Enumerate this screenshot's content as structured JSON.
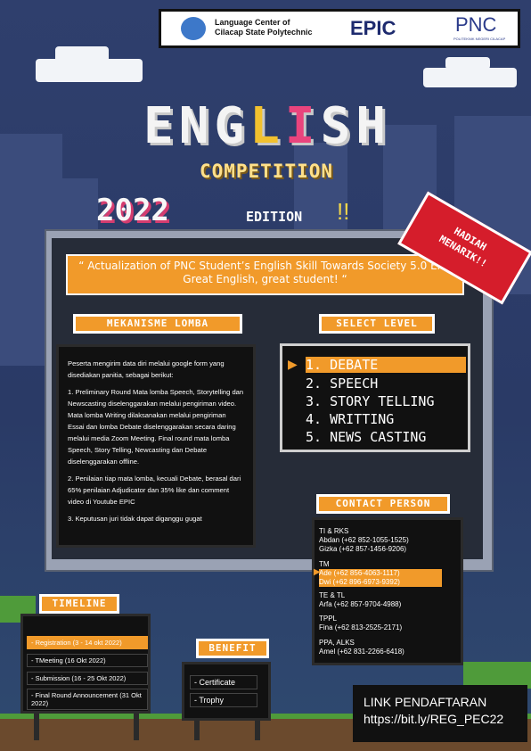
{
  "header": {
    "org_name": "Language Center of Cilacap State Polytechnic",
    "epic_logo": "EPIC",
    "pnc_logo": "PNC",
    "pnc_subtitle": "POLITEKNIK NEGERI CILACAP"
  },
  "title": {
    "letters": [
      "E",
      "N",
      "G",
      "L",
      "I",
      "S",
      "H"
    ],
    "letter_colors": [
      "#f4f4f4",
      "#f4f4f4",
      "#f4f4f4",
      "#f2c12e",
      "#e9447d",
      "#f4f4f4",
      "#f4f4f4"
    ],
    "subtitle": "COMPETITION",
    "year": "2022",
    "edition": "EDITION",
    "bang": "!!"
  },
  "ribbon": {
    "line1": "HADIAH",
    "line2": "MENARIK!!"
  },
  "quote": "“ Actualization of PNC Student’s English Skill Towards Society 5.0 Era. Great English, great student! “",
  "mekanisme": {
    "heading": "MEKANISME LOMBA",
    "intro": "Peserta mengirim data diri melalui google form yang disediakan panitia, sebagai berikut:",
    "items": [
      "1.   Preliminary Round Mata lomba Speech, Storytelling dan Newscasting diselenggarakan melalui pengiriman video. Mata lomba Writing dilaksanakan melalui pengiriman Essai dan lomba Debate diselenggarakan secara daring melalui media Zoom Meeting. Final round mata lomba Speech, Story Telling, Newcasting dan Debate diselenggarakan offline.",
      "2. Penilaian tiap mata lomba, kecuali Debate, berasal dari 65% penilaian Adjudicator dan 35% like dan comment video di Youtube EPIC",
      "3.   Keputusan juri tidak dapat diganggu gugat"
    ]
  },
  "level": {
    "heading": "SELECT LEVEL",
    "items": [
      "1. DEBATE",
      "2. SPEECH",
      "3. STORY TELLING",
      "4. WRITTING",
      "5. NEWS CASTING"
    ],
    "selected_index": 0,
    "cursor": "▶"
  },
  "contact": {
    "heading": "CONTACT PERSON",
    "groups": [
      {
        "name": "TI & RKS",
        "lines": [
          "Abdan (+62 852-1055-1525)",
          "Gizka (+62 857-1456-9206)"
        ]
      },
      {
        "name": "TM",
        "lines": [
          "Ade (+62 856-4063-1117)",
          "Dwi (+62 896-6973-9392)"
        ]
      },
      {
        "name": "TE & TL",
        "lines": [
          "Arfa (+62 857-9704-4988)"
        ]
      },
      {
        "name": "TPPL",
        "lines": [
          "Fina (+62 813-2525-2171)"
        ]
      },
      {
        "name": "PPA, ALKS",
        "lines": [
          "Amel (+62 831-2266-6418)"
        ]
      }
    ],
    "selected_index": 1,
    "cursor": "▶"
  },
  "timeline": {
    "heading": "TIMELINE",
    "items": [
      "- Registration (3 - 14 okt 2022)",
      "- TMeeting (16 Okt 2022)",
      "- Submission (16 - 25 Okt 2022)",
      "- Final Round Announcement (31 Okt 2022)"
    ]
  },
  "benefit": {
    "heading": "BENEFIT",
    "items": [
      "- Certificate",
      "- Trophy"
    ]
  },
  "link": {
    "label": "LINK PENDAFTARAN",
    "url": "https://bit.ly/REG_PEC22"
  },
  "colors": {
    "accent": "#f19a2a",
    "sky": "#2f3f6d",
    "ribbon": "#d51d2b"
  }
}
